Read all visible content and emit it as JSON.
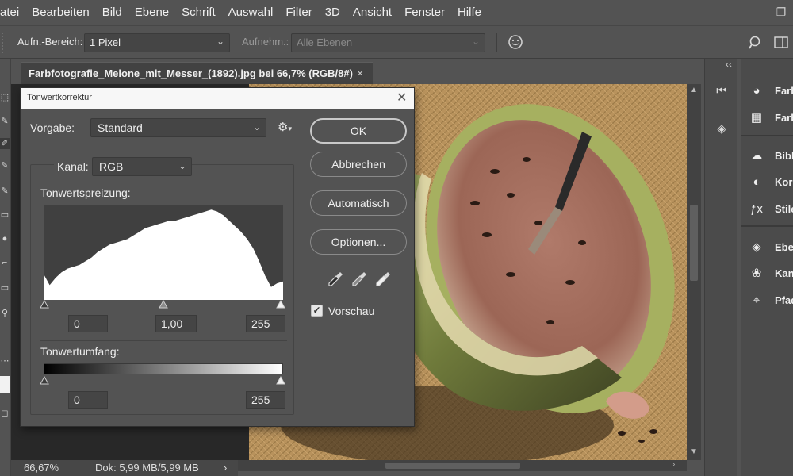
{
  "menubar": {
    "items": [
      "atei",
      "Bearbeiten",
      "Bild",
      "Ebene",
      "Schrift",
      "Auswahl",
      "Filter",
      "3D",
      "Ansicht",
      "Fenster",
      "Hilfe"
    ],
    "window_controls": [
      "minimize-icon",
      "restore-icon"
    ]
  },
  "optionsbar": {
    "sample_size_label": "Aufn.-Bereich:",
    "sample_size_value": "1 Pixel",
    "sample_layers_label": "Aufnehm.:",
    "sample_layers_value": "Alle Ebenen"
  },
  "document": {
    "tab_title": "Farbfotografie_Melone_mit_Messer_(1892).jpg bei 66,7% (RGB/8#)",
    "close_glyph": "×"
  },
  "statusbar": {
    "zoom": "66,67%",
    "doc_info": "Dok: 5,99 MB/5,99 MB",
    "arrow": "›"
  },
  "panels": {
    "items": [
      {
        "icon": "palette-icon",
        "label": "Farb"
      },
      {
        "icon": "swatches-grid-icon",
        "label": "Farb"
      },
      {
        "icon": "libraries-cloud-icon",
        "label": "Bibl"
      },
      {
        "icon": "adjustments-icon",
        "label": "Korr"
      },
      {
        "icon": "styles-fx-icon",
        "label": "Stile"
      },
      {
        "icon": "layers-icon",
        "label": "Ebe"
      },
      {
        "icon": "channels-icon",
        "label": "Kana"
      },
      {
        "icon": "paths-icon",
        "label": "Pfad"
      }
    ],
    "collapse_glyph": "‹‹"
  },
  "dialog": {
    "title": "Tonwertkorrektur",
    "close_glyph": "✕",
    "preset_label": "Vorgabe:",
    "preset_value": "Standard",
    "channel_label": "Kanal:",
    "channel_value": "RGB",
    "input_levels_label": "Tonwertspreizung:",
    "input_black": "0",
    "input_gamma": "1,00",
    "input_white": "255",
    "output_levels_label": "Tonwertumfang:",
    "output_black": "0",
    "output_white": "255",
    "buttons": {
      "ok": "OK",
      "cancel": "Abbrechen",
      "auto": "Automatisch",
      "options": "Optionen..."
    },
    "preview_label": "Vorschau",
    "preview_checked": true,
    "histogram_values": [
      0.28,
      0.16,
      0.24,
      0.3,
      0.34,
      0.36,
      0.38,
      0.42,
      0.46,
      0.52,
      0.56,
      0.6,
      0.62,
      0.64,
      0.66,
      0.7,
      0.74,
      0.78,
      0.8,
      0.82,
      0.84,
      0.86,
      0.86,
      0.88,
      0.9,
      0.92,
      0.94,
      0.96,
      0.98,
      0.96,
      0.92,
      0.86,
      0.8,
      0.74,
      0.66,
      0.56,
      0.42,
      0.26,
      0.14,
      0.18,
      0.2
    ]
  },
  "colors": {
    "app_bg": "#535353",
    "panel_bg": "#4b4b4b",
    "dialog_title_bg": "#f7f7f7"
  }
}
